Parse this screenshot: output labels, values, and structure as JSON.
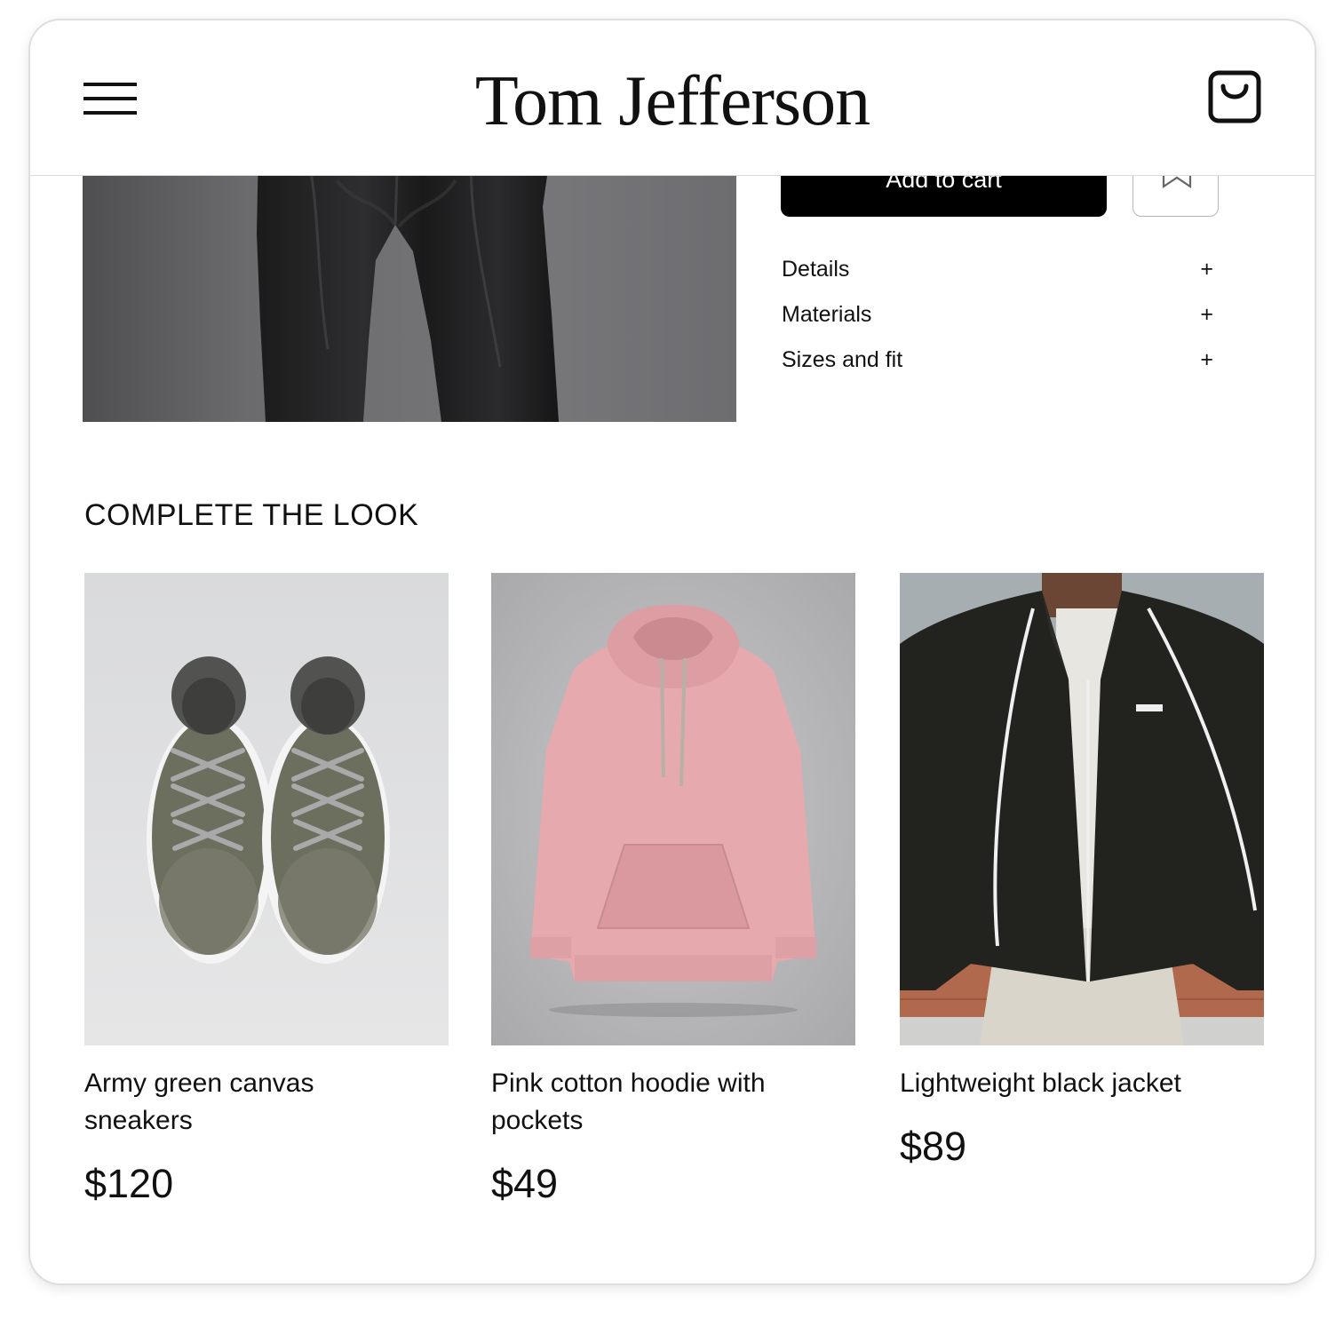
{
  "header": {
    "brand": "Tom Jefferson",
    "menu_icon": "hamburger-menu-icon",
    "cart_icon": "shopping-bag-icon"
  },
  "product": {
    "add_to_cart_label": "Add to cart",
    "wishlist_icon": "bookmark-icon",
    "accordions": [
      {
        "label": "Details",
        "toggle": "+"
      },
      {
        "label": "Materials",
        "toggle": "+"
      },
      {
        "label": "Sizes and fit",
        "toggle": "+"
      }
    ]
  },
  "complete_the_look": {
    "title": "COMPLETE THE LOOK",
    "items": [
      {
        "name": "Army green canvas sneakers",
        "price": "$120"
      },
      {
        "name": "Pink cotton hoodie with pockets",
        "price": "$49"
      },
      {
        "name": "Lightweight black jacket",
        "price": "$89"
      }
    ]
  }
}
